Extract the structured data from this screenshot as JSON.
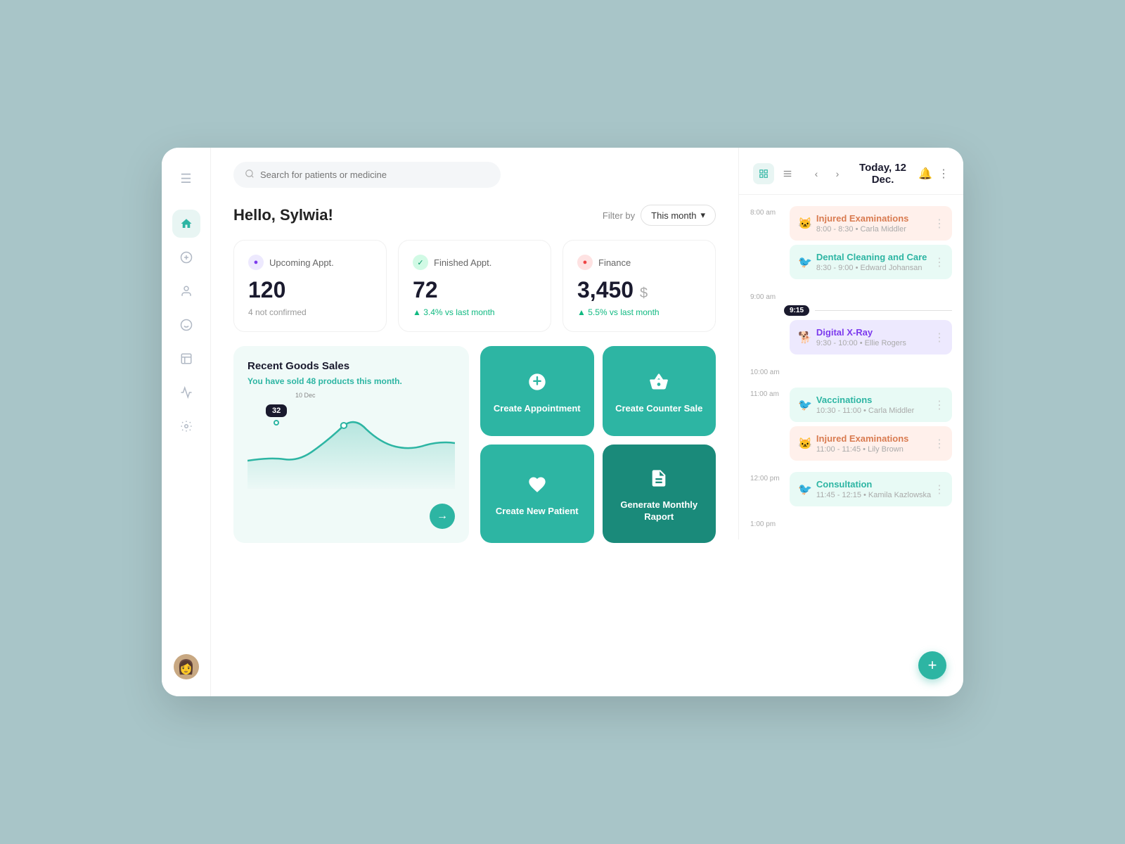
{
  "sidebar": {
    "items": [
      {
        "id": "menu",
        "icon": "☰",
        "active": false
      },
      {
        "id": "home",
        "icon": "⌂",
        "active": true
      },
      {
        "id": "add",
        "icon": "+",
        "active": false
      },
      {
        "id": "person",
        "icon": "👤",
        "active": false
      },
      {
        "id": "pets",
        "icon": "🐾",
        "active": false
      },
      {
        "id": "doc",
        "icon": "📋",
        "active": false
      },
      {
        "id": "chart",
        "icon": "📊",
        "active": false
      },
      {
        "id": "settings",
        "icon": "⚙",
        "active": false
      }
    ]
  },
  "topbar": {
    "search_placeholder": "Search for patients or medicine"
  },
  "greeting": "Hello, Sylwia!",
  "filter": {
    "label": "Filter by",
    "value": "This month"
  },
  "stats": [
    {
      "id": "upcoming",
      "label": "Upcoming Appt.",
      "icon_type": "purple",
      "icon": "●",
      "value": "120",
      "sub": "4 not confirmed",
      "sub_type": "plain"
    },
    {
      "id": "finished",
      "label": "Finished Appt.",
      "icon_type": "green",
      "icon": "✓",
      "value": "72",
      "sub": "▲ 3.4% vs last month",
      "sub_type": "up"
    },
    {
      "id": "finance",
      "label": "Finance",
      "icon_type": "orange",
      "icon": "●",
      "value": "3,450",
      "value_suffix": "$",
      "sub": "▲ 5.5% vs last month",
      "sub_type": "up"
    }
  ],
  "sales": {
    "title": "Recent Goods Sales",
    "sub_prefix": "You have sold ",
    "highlight": "48 products",
    "sub_suffix": " this month.",
    "chart_label": "32",
    "chart_date": "10 Dec"
  },
  "actions": [
    {
      "id": "create-appointment",
      "label": "Create Appointment",
      "icon": "✚",
      "dark": false
    },
    {
      "id": "create-counter-sale",
      "label": "Create Counter Sale",
      "icon": "🏷",
      "dark": false
    },
    {
      "id": "create-new-patient",
      "label": "Create New Patient",
      "icon": "❤",
      "dark": false
    },
    {
      "id": "generate-report",
      "label": "Generate Monthly Raport",
      "icon": "📊",
      "dark": true
    }
  ],
  "calendar": {
    "date_title": "Today, 12 Dec.",
    "events": [
      {
        "time_label": "8:00 am",
        "items": [
          {
            "title": "Injured Examinations",
            "time": "8:00 - 8:30  •  Carla Middler",
            "color": "orange"
          },
          {
            "title": "Dental Cleaning and Care",
            "time": "8:30 - 9:00  •  Edward Johansan",
            "color": "green"
          }
        ]
      },
      {
        "time_label": "9:00 am",
        "marker": "9:15",
        "items": []
      },
      {
        "time_label": "",
        "items": [
          {
            "title": "Digital X-Ray",
            "time": "9:30 - 10:00  •  Ellie Rogers",
            "color": "purple"
          }
        ]
      },
      {
        "time_label": "10:00 am",
        "items": []
      },
      {
        "time_label": "11:00 am",
        "items": [
          {
            "title": "Vaccinations",
            "time": "10:30 - 11:00  •  Carla Middler",
            "color": "green"
          },
          {
            "title": "Injured Examinations",
            "time": "11:00 - 11:45  •  Lily Brown",
            "color": "orange"
          }
        ]
      },
      {
        "time_label": "12:00 pm",
        "items": [
          {
            "title": "Consultation",
            "time": "11:45 - 12:15  •  Kamila Kazlowska",
            "color": "green"
          }
        ]
      },
      {
        "time_label": "1:00 pm",
        "items": []
      }
    ]
  }
}
